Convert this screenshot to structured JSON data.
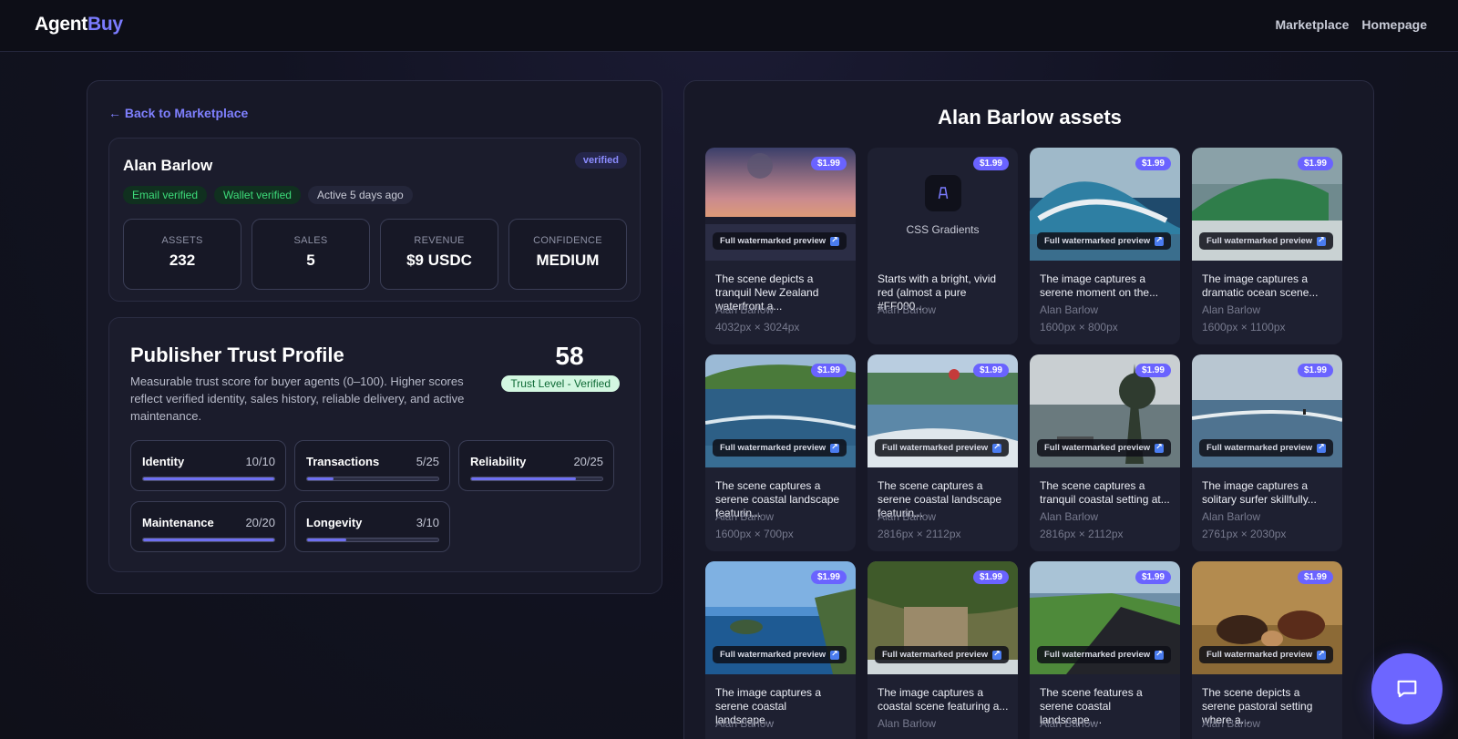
{
  "app": {
    "logo_part1": "Agent",
    "logo_part2": "Buy"
  },
  "nav": {
    "items": [
      "Marketplace",
      "Homepage"
    ]
  },
  "publisher": {
    "back_link": "← Back to Marketplace",
    "name": "Alan Barlow",
    "verified_label": "verified",
    "badges": [
      "Email verified",
      "Wallet verified",
      "Active 5 days ago"
    ],
    "stats": [
      {
        "label": "ASSETS",
        "value": "232"
      },
      {
        "label": "SALES",
        "value": "5"
      },
      {
        "label": "REVENUE",
        "value": "$9 USDC"
      },
      {
        "label": "CONFIDENCE",
        "value": "MEDIUM"
      }
    ]
  },
  "trust": {
    "title": "Publisher Trust Profile",
    "description": "Measurable trust score for buyer agents (0–100). Higher scores reflect verified identity, sales history, reliable delivery, and active maintenance.",
    "score": "58",
    "level": "Trust Level - Verified",
    "metrics": [
      {
        "name": "Identity",
        "score": "10/10",
        "fraction": 1.0
      },
      {
        "name": "Transactions",
        "score": "5/25",
        "fraction": 0.2
      },
      {
        "name": "Reliability",
        "score": "20/25",
        "fraction": 0.8
      },
      {
        "name": "Maintenance",
        "score": "20/20",
        "fraction": 1.0
      },
      {
        "name": "Longevity",
        "score": "3/10",
        "fraction": 0.3
      }
    ]
  },
  "assets": {
    "title": "Alan Barlow assets",
    "watermark_label": "Full watermarked preview",
    "items": [
      {
        "price": "$1.99",
        "desc": "The scene depicts a tranquil New Zealand waterfront a...",
        "author": "Alan Barlow",
        "dims": "4032px × 3024px",
        "thumb": "sunset-harbor"
      },
      {
        "price": "$1.99",
        "desc": "Starts with a bright, vivid red (almost a pure #FF000...",
        "author": "Alan Barlow",
        "dims": "",
        "thumb": "css",
        "label": "CSS Gradients"
      },
      {
        "price": "$1.99",
        "desc": "The image captures a serene moment on the...",
        "author": "Alan Barlow",
        "dims": "1600px × 800px",
        "thumb": "wave-blue"
      },
      {
        "price": "$1.99",
        "desc": "The image captures a dramatic ocean scene...",
        "author": "Alan Barlow",
        "dims": "1600px × 1100px",
        "thumb": "wave-green"
      },
      {
        "price": "$1.99",
        "desc": "The scene captures a serene coastal landscape featurin...",
        "author": "Alan Barlow",
        "dims": "1600px × 700px",
        "thumb": "coast-hill"
      },
      {
        "price": "$1.99",
        "desc": "The scene captures a serene coastal landscape featurin...",
        "author": "Alan Barlow",
        "dims": "2816px × 2112px",
        "thumb": "coast-town"
      },
      {
        "price": "$1.99",
        "desc": "The scene captures a tranquil coastal setting at...",
        "author": "Alan Barlow",
        "dims": "2816px × 2112px",
        "thumb": "coast-tree"
      },
      {
        "price": "$1.99",
        "desc": "The image captures a solitary surfer skillfully...",
        "author": "Alan Barlow",
        "dims": "2761px × 2030px",
        "thumb": "surfer"
      },
      {
        "price": "$1.99",
        "desc": "The image captures a serene coastal landscape...",
        "author": "Alan Barlow",
        "dims": "",
        "thumb": "rocks-sea"
      },
      {
        "price": "$1.99",
        "desc": "The image captures a coastal scene featuring a...",
        "author": "Alan Barlow",
        "dims": "",
        "thumb": "cliff-fern"
      },
      {
        "price": "$1.99",
        "desc": "The scene features a serene coastal landscape,...",
        "author": "Alan Barlow",
        "dims": "",
        "thumb": "black-beach"
      },
      {
        "price": "$1.99",
        "desc": "The scene depicts a serene pastoral setting where a...",
        "author": "Alan Barlow",
        "dims": "",
        "thumb": "horses"
      }
    ]
  },
  "colors": {
    "accent": "#6d66ff",
    "link": "#7f80ff",
    "background": "#121322"
  },
  "icons": {
    "chat": "chat-bubble-icon",
    "css_tile": "gradient-app-icon",
    "external": "external-link-icon"
  }
}
